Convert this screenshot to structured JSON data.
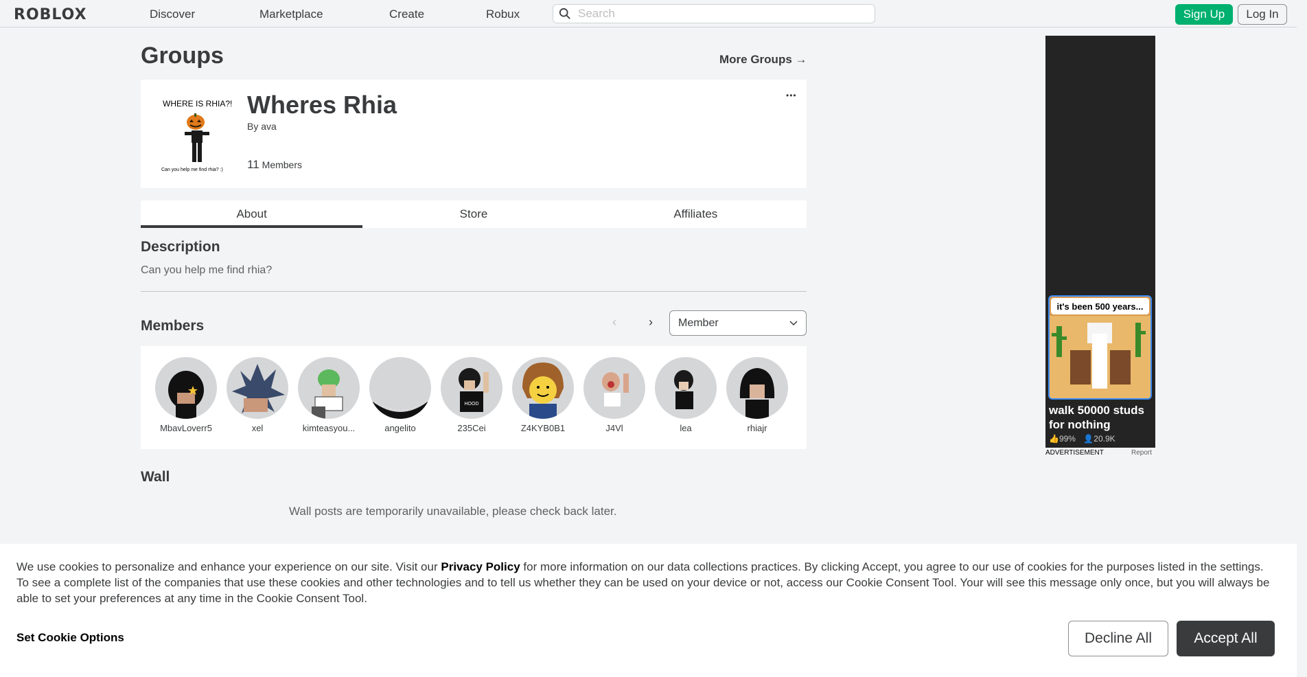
{
  "nav": {
    "logo": "RΟBLOX",
    "links": [
      "Discover",
      "Marketplace",
      "Create",
      "Robux"
    ],
    "search_placeholder": "Search",
    "signup_label": "Sign Up",
    "login_label": "Log In"
  },
  "page": {
    "title": "Groups",
    "more_groups_label": "More Groups →"
  },
  "group": {
    "emblem_top_text": "WHERE IS RHIA?!",
    "emblem_bottom_text": "Can you help me find rhia? :)",
    "name": "Wheres Rhia",
    "owner_prefix": "By",
    "owner": "ava",
    "member_count": "11",
    "member_label": "Members",
    "menu_icon": "•••"
  },
  "tabs": [
    {
      "label": "About",
      "active": true
    },
    {
      "label": "Store",
      "active": false
    },
    {
      "label": "Affiliates",
      "active": false
    }
  ],
  "description": {
    "heading": "Description",
    "text": "Can you help me find rhia?"
  },
  "members": {
    "heading": "Members",
    "prev_icon": "‹",
    "next_icon": "›",
    "role_selected": "Member",
    "list": [
      {
        "name": "MbavLoverr5"
      },
      {
        "name": "xel"
      },
      {
        "name": "kimteasyou..."
      },
      {
        "name": "angelito"
      },
      {
        "name": "235Cei"
      },
      {
        "name": "Z4KYB0B1"
      },
      {
        "name": "J4Vl"
      },
      {
        "name": "lea"
      },
      {
        "name": "rhiajr"
      }
    ]
  },
  "wall": {
    "heading": "Wall",
    "message": "Wall posts are temporarily unavailable, please check back later."
  },
  "ad": {
    "bubble": "it's been 500 years...",
    "title": "walk 50000 studs for nothing",
    "rating": "99%",
    "players": "20.9K",
    "label": "ADVERTISEMENT",
    "report": "Report"
  },
  "cookie": {
    "text_before": "We use cookies to personalize and enhance your experience on our site. Visit our ",
    "privacy_link": "Privacy Policy",
    "text_after": " for more information on our data collections practices. By clicking Accept, you agree to our use of cookies for the purposes listed in the settings. To see a complete list of the companies that use these cookies and other technologies and to tell us whether they can be used on your device or not, access our Cookie Consent Tool. Your will see this message only once, but you will always be able to set your preferences at any time in the Cookie Consent Tool.",
    "options_label": "Set Cookie Options",
    "decline_label": "Decline All",
    "accept_label": "Accept All"
  },
  "colors": {
    "accent_green": "#00b06f",
    "text_dark": "#393b3d",
    "page_bg": "#f2f4f5"
  }
}
